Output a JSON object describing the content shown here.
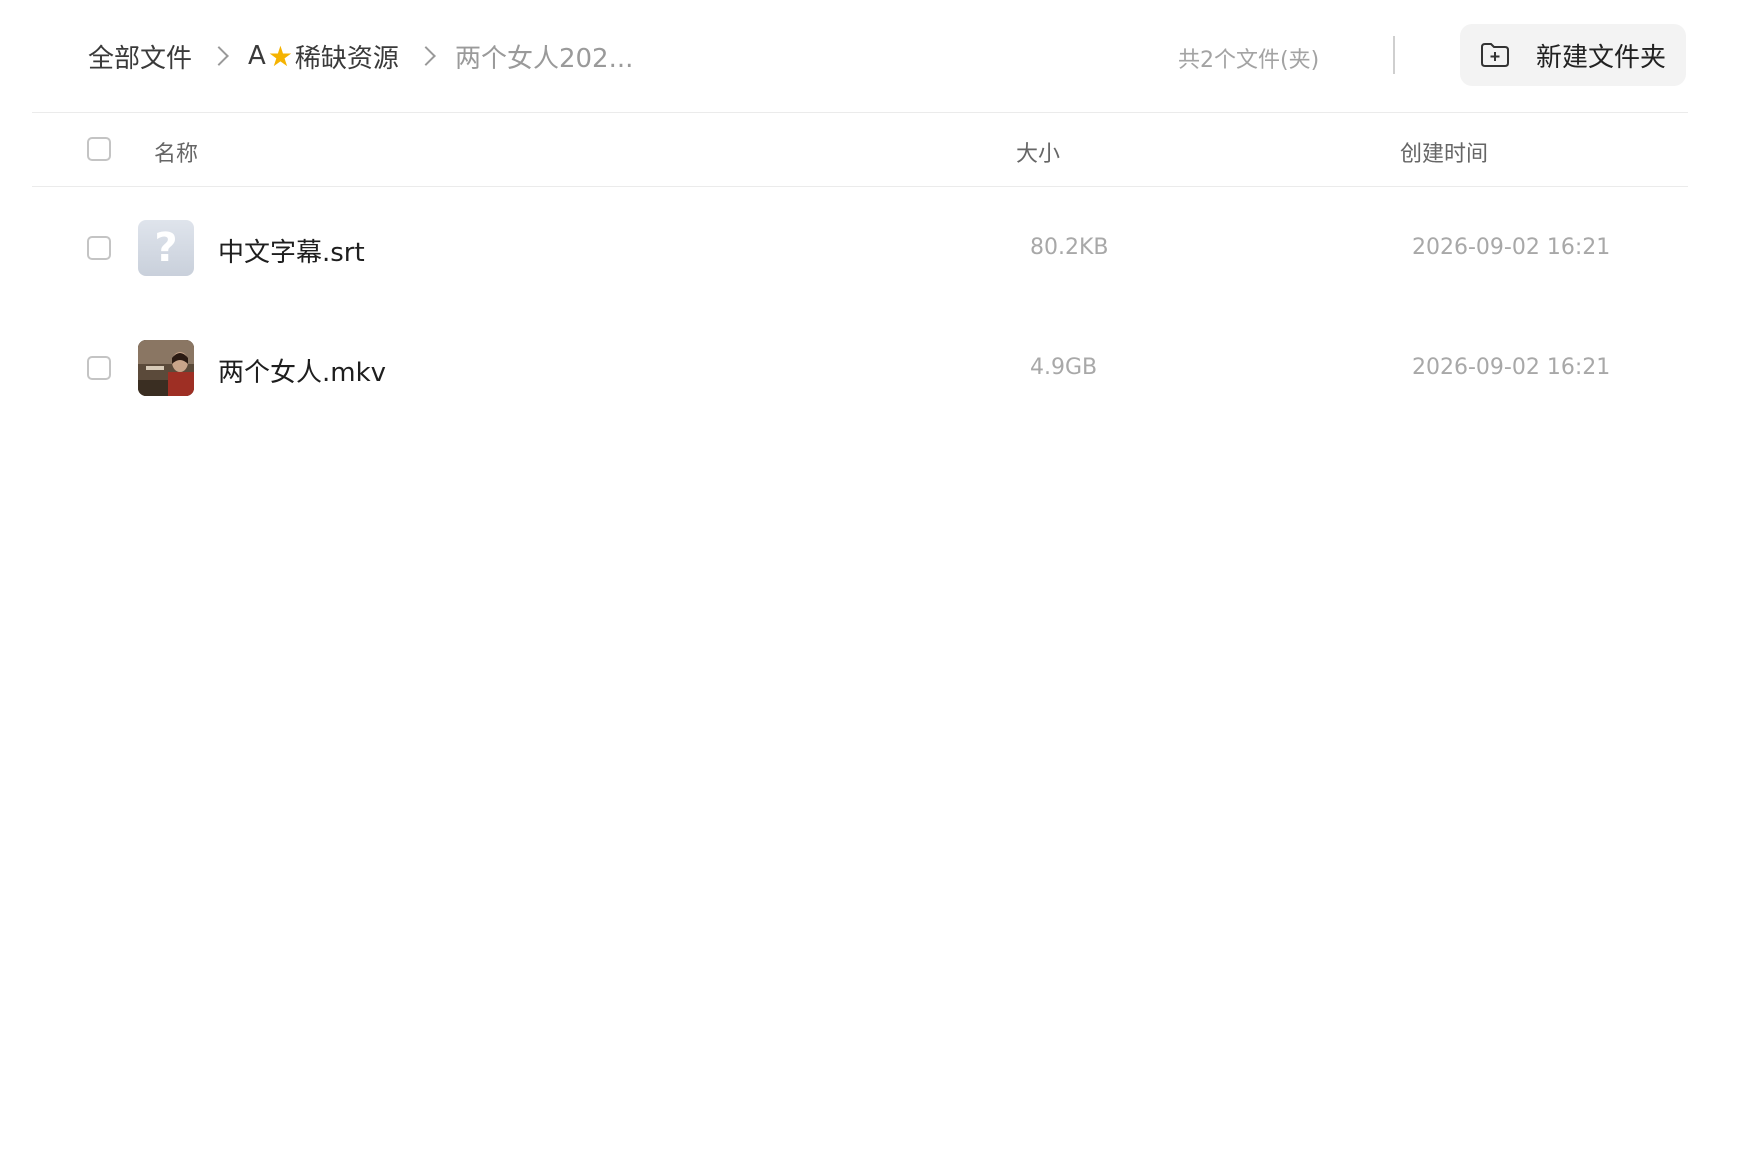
{
  "breadcrumb": {
    "root": "全部文件",
    "parent_prefix": "A",
    "parent_suffix": "稀缺资源",
    "current": "两个女人202..."
  },
  "file_count": "共2个文件(夹)",
  "new_folder_label": "新建文件夹",
  "columns": {
    "name": "名称",
    "size": "大小",
    "created": "创建时间"
  },
  "files": [
    {
      "name": "中文字幕.srt",
      "size": "80.2KB",
      "created": "2026-09-02 16:21",
      "icon": "unknown-file-icon"
    },
    {
      "name": "两个女人.mkv",
      "size": "4.9GB",
      "created": "2026-09-02 16:21",
      "icon": "video-thumbnail"
    }
  ]
}
